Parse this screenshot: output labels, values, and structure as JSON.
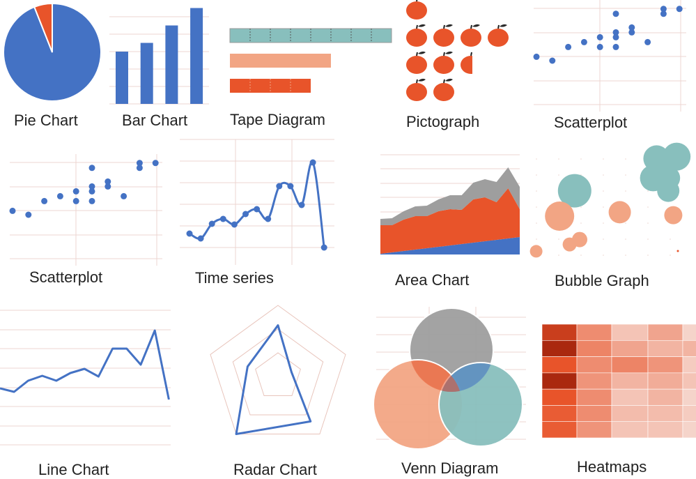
{
  "labels": {
    "pie": "Pie Chart",
    "bar": "Bar Chart",
    "tape": "Tape Diagram",
    "picto": "Pictograph",
    "scatter1": "Scatterplot",
    "scatter2": "Scatterplot",
    "time": "Time series",
    "area": "Area Chart",
    "bubble": "Bubble Graph",
    "line": "Line Chart",
    "radar": "Radar Chart",
    "venn": "Venn Diagram",
    "heat": "Heatmaps"
  },
  "colors": {
    "blue": "#4472c4",
    "orange": "#e8542a",
    "salmon": "#f2a584",
    "teal": "#88bfbd",
    "gray": "#9e9e9e",
    "grid": "#ecd5d0"
  },
  "chart_data": [
    {
      "id": "pie",
      "type": "pie",
      "values": [
        94,
        6
      ],
      "colors": [
        "#4472c4",
        "#e8542a"
      ]
    },
    {
      "id": "bar",
      "type": "bar",
      "values": [
        3,
        3.5,
        4.5,
        5.5
      ],
      "ylim": [
        0,
        5
      ],
      "grid": true
    },
    {
      "id": "tape",
      "type": "bar",
      "orientation": "horizontal",
      "values": [
        8,
        5,
        4
      ],
      "colors": [
        "#88bfbd",
        "#f2a584",
        "#e8542a"
      ]
    },
    {
      "id": "picto",
      "type": "pictograph",
      "icon": "apple-icon",
      "values": [
        1,
        4,
        2.5,
        2
      ]
    },
    {
      "id": "scatter",
      "type": "scatter",
      "grid": true,
      "xlim": [
        0,
        9
      ],
      "ylim": [
        0,
        10
      ],
      "x": [
        0,
        1,
        2,
        3,
        4,
        4,
        5,
        5,
        5,
        5,
        6,
        6,
        7,
        8,
        8,
        9
      ],
      "y": [
        4.9,
        4.5,
        5.9,
        6.4,
        6.9,
        5.9,
        9.3,
        7.4,
        6.9,
        5.9,
        7.9,
        7.4,
        6.4,
        9.8,
        9.3,
        9.8
      ]
    },
    {
      "id": "time",
      "type": "line",
      "smooth": true,
      "values": [
        4.5,
        3.8,
        5.9,
        6.6,
        5.8,
        7.3,
        8,
        6.6,
        11.3,
        11.3,
        8.6,
        14.7,
        2.5
      ]
    },
    {
      "id": "area",
      "type": "area",
      "stacked": true,
      "series": [
        {
          "values": [
            0.1,
            0.3,
            0.5,
            0.7,
            0.9,
            1.1,
            1.3,
            1.5,
            1.7,
            1.9,
            2.1,
            2.3,
            2.5
          ],
          "color": "#4472c4"
        },
        {
          "values": [
            4.1,
            3.9,
            4.5,
            4.8,
            4.6,
            5.1,
            5.2,
            4.9,
            6.2,
            6.3,
            5.4,
            7.2,
            4.0
          ],
          "color": "#e8542a"
        },
        {
          "values": [
            0.9,
            1.0,
            1.2,
            1.4,
            1.5,
            1.7,
            2.0,
            2.1,
            2.4,
            2.6,
            2.9,
            3.0,
            3.2
          ],
          "color": "#9e9e9e"
        }
      ]
    },
    {
      "id": "bubble",
      "type": "scatter",
      "bubbles": [
        {
          "x": 2.7,
          "y": 7.6,
          "size": 24,
          "color": "#88bfbd"
        },
        {
          "x": 7.6,
          "y": 10.9,
          "size": 19,
          "color": "#88bfbd"
        },
        {
          "x": 8.8,
          "y": 11.1,
          "size": 20,
          "color": "#88bfbd"
        },
        {
          "x": 7.4,
          "y": 8.9,
          "size": 19,
          "color": "#88bfbd"
        },
        {
          "x": 8.3,
          "y": 8.9,
          "size": 17,
          "color": "#88bfbd"
        },
        {
          "x": 8.3,
          "y": 7.6,
          "size": 16,
          "color": "#88bfbd"
        },
        {
          "x": 1.8,
          "y": 5.0,
          "size": 21,
          "color": "#f2a584"
        },
        {
          "x": 5.4,
          "y": 5.4,
          "size": 16,
          "color": "#f2a584"
        },
        {
          "x": 8.6,
          "y": 5.1,
          "size": 13,
          "color": "#f2a584"
        },
        {
          "x": 2.4,
          "y": 2.1,
          "size": 10,
          "color": "#f2a584"
        },
        {
          "x": 3.0,
          "y": 2.6,
          "size": 11,
          "color": "#f2a584"
        },
        {
          "x": 0.4,
          "y": 1.4,
          "size": 9,
          "color": "#f2a584"
        }
      ]
    },
    {
      "id": "line",
      "type": "line",
      "grid": true,
      "values": [
        8.3,
        7.8,
        9.4,
        10.1,
        9.4,
        10.5,
        11.1,
        10.0,
        14.0,
        14.0,
        11.7,
        16.6,
        6.7
      ]
    },
    {
      "id": "radar",
      "type": "radar",
      "rings": 3,
      "values": [
        0.72,
        0.2,
        0.78,
        1.0,
        0.45
      ]
    },
    {
      "id": "venn",
      "type": "venn",
      "sets": [
        {
          "color": "#9e9e9e"
        },
        {
          "color": "#f2a584"
        },
        {
          "color": "#88bfbd"
        }
      ]
    },
    {
      "id": "heat",
      "type": "heatmap",
      "values": [
        [
          0.95,
          0.55,
          0.2,
          0.4,
          0.1
        ],
        [
          1.0,
          0.6,
          0.4,
          0.3,
          0.3
        ],
        [
          0.9,
          0.55,
          0.6,
          0.5,
          0.15
        ],
        [
          1.0,
          0.5,
          0.3,
          0.35,
          0.2
        ],
        [
          0.9,
          0.55,
          0.2,
          0.3,
          0.1
        ],
        [
          0.85,
          0.55,
          0.25,
          0.25,
          0.15
        ],
        [
          0.85,
          0.5,
          0.2,
          0.2,
          0.1
        ]
      ]
    }
  ]
}
